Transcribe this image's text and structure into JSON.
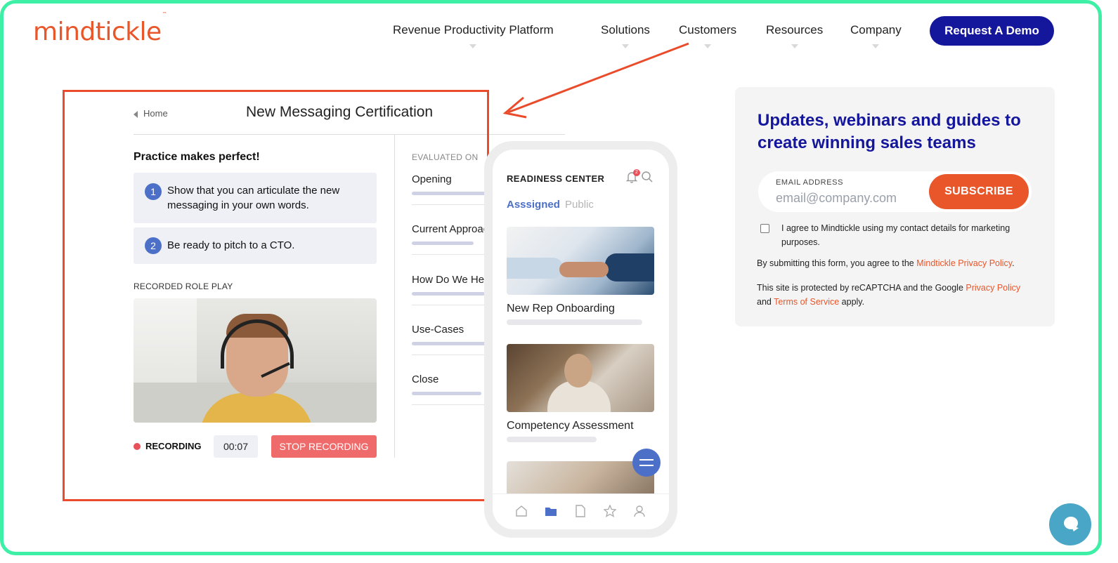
{
  "brand": {
    "logo_text": "mindtickle",
    "logo_tm": "™",
    "accent": "#e8562a",
    "primary": "#14169c",
    "frame_color": "#3ef0a6"
  },
  "nav": {
    "items": [
      {
        "label": "Revenue Productivity Platform"
      },
      {
        "label": "Solutions"
      },
      {
        "label": "Customers"
      },
      {
        "label": "Resources"
      },
      {
        "label": "Company"
      }
    ],
    "cta_label": "Request A Demo"
  },
  "app": {
    "breadcrumb": "Home",
    "title": "New Messaging Certification",
    "practice_heading": "Practice makes perfect!",
    "tasks": [
      {
        "num": "1",
        "text": "Show that you can articulate the new messaging in your own words."
      },
      {
        "num": "2",
        "text": "Be ready to pitch to a CTO."
      }
    ],
    "role_play_label": "RECORDED ROLE PLAY",
    "recording_label": "RECORDING",
    "timer": "00:07",
    "stop_label": "STOP RECORDING",
    "evaluated_label": "EVALUATED ON",
    "criteria": [
      {
        "name": "Opening",
        "progress": 0.7
      },
      {
        "name": "Current Approach",
        "progress": 0.55
      },
      {
        "name": "How Do We Help",
        "progress": 0.65
      },
      {
        "name": "Use-Cases",
        "progress": 0.7
      },
      {
        "name": "Close",
        "progress": 0.62
      }
    ]
  },
  "phone": {
    "title": "READINESS CENTER",
    "notification_count": "2",
    "tabs": {
      "assigned": "Asssigned",
      "public": "Public"
    },
    "cards": [
      {
        "title": "New Rep Onboarding"
      },
      {
        "title": "Competency Assessment"
      }
    ],
    "bottom_nav_icons": [
      "home-icon",
      "folder-icon",
      "document-icon",
      "star-icon",
      "profile-icon"
    ]
  },
  "newsletter": {
    "title": "Updates, webinars and guides to create winning sales teams",
    "email_label": "EMAIL ADDRESS",
    "email_placeholder": "email@company.com",
    "subscribe_label": "SUBSCRIBE",
    "consent_text": "I agree to Mindtickle using my contact details for marketing purposes.",
    "submit_prefix": "By submitting this form, you agree to the ",
    "privacy_link_1": "Mindtickle Privacy Policy",
    "submit_suffix": ".",
    "recaptcha_prefix": "This site is protected by reCAPTCHA and the Google ",
    "privacy_link_2": "Privacy Policy",
    "recaptcha_and": "and ",
    "terms_link": "Terms of Service",
    "recaptcha_suffix": " apply."
  }
}
